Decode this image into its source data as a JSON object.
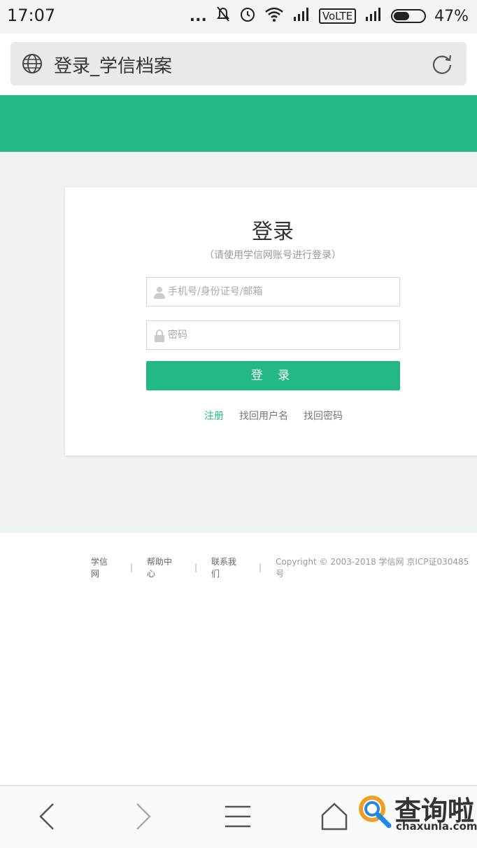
{
  "status_bar": {
    "time": "17:07",
    "dots": "...",
    "network_label": "VoLTE",
    "battery_percent": "47%",
    "battery_level": 0.47
  },
  "browser": {
    "page_title": "登录_学信档案"
  },
  "login": {
    "title": "登录",
    "subtitle": "（请使用学信网账号进行登录）",
    "username_placeholder": "手机号/身份证号/邮箱",
    "password_placeholder": "密码",
    "submit_label": "登 录",
    "links": {
      "register": "注册",
      "find_username": "找回用户名",
      "find_password": "找回密码"
    }
  },
  "footer": {
    "links": [
      "学信网",
      "帮助中心",
      "联系我们"
    ],
    "separator": "|",
    "copyright": "Copyright © 2003-2018 学信网 京ICP证030485号"
  },
  "watermark": {
    "text": "查询啦",
    "domain": "chaxunla.com"
  },
  "colors": {
    "brand_green": "#24b886",
    "page_bg": "#eff3f2"
  }
}
